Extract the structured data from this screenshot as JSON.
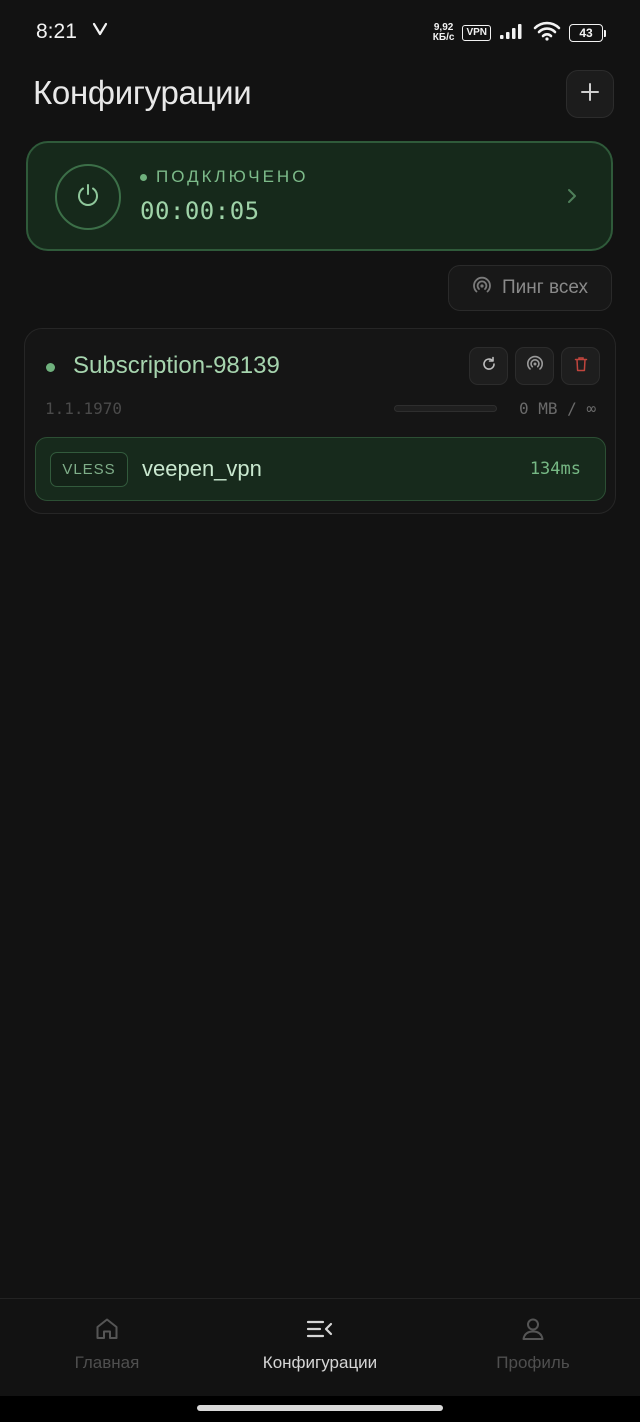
{
  "status_bar": {
    "time": "8:21",
    "net_speed_value": "9,92",
    "net_speed_unit": "КБ/с",
    "vpn_label": "VPN",
    "battery_level": "43",
    "icons": [
      "v-carrier-icon",
      "signal-icon",
      "wifi-icon",
      "battery-icon"
    ]
  },
  "header": {
    "title": "Конфигурации",
    "add_icon": "plus-icon"
  },
  "connection": {
    "status": "ПОДКЛЮЧЕНО",
    "timer": "00:00:05",
    "accent_color": "#6fb17d",
    "icons": [
      "power-icon",
      "chevron-right-icon"
    ]
  },
  "ping_all": {
    "label": "Пинг всех",
    "icon": "signal-ping-icon"
  },
  "subscription": {
    "name": "Subscription-98139",
    "date": "1.1.1970",
    "usage": "0 MB / ∞",
    "usage_fraction": 0,
    "actions": [
      "refresh-icon",
      "ping-icon",
      "trash-icon"
    ],
    "delete_color": "#c0453d",
    "servers": [
      {
        "protocol": "VLESS",
        "name": "veepen_vpn",
        "ping": "134ms"
      }
    ]
  },
  "bottom_nav": {
    "items": [
      {
        "label": "Главная",
        "icon": "home-icon",
        "active": false
      },
      {
        "label": "Конфигурации",
        "icon": "list-icon",
        "active": true
      },
      {
        "label": "Профиль",
        "icon": "user-icon",
        "active": false
      }
    ]
  }
}
